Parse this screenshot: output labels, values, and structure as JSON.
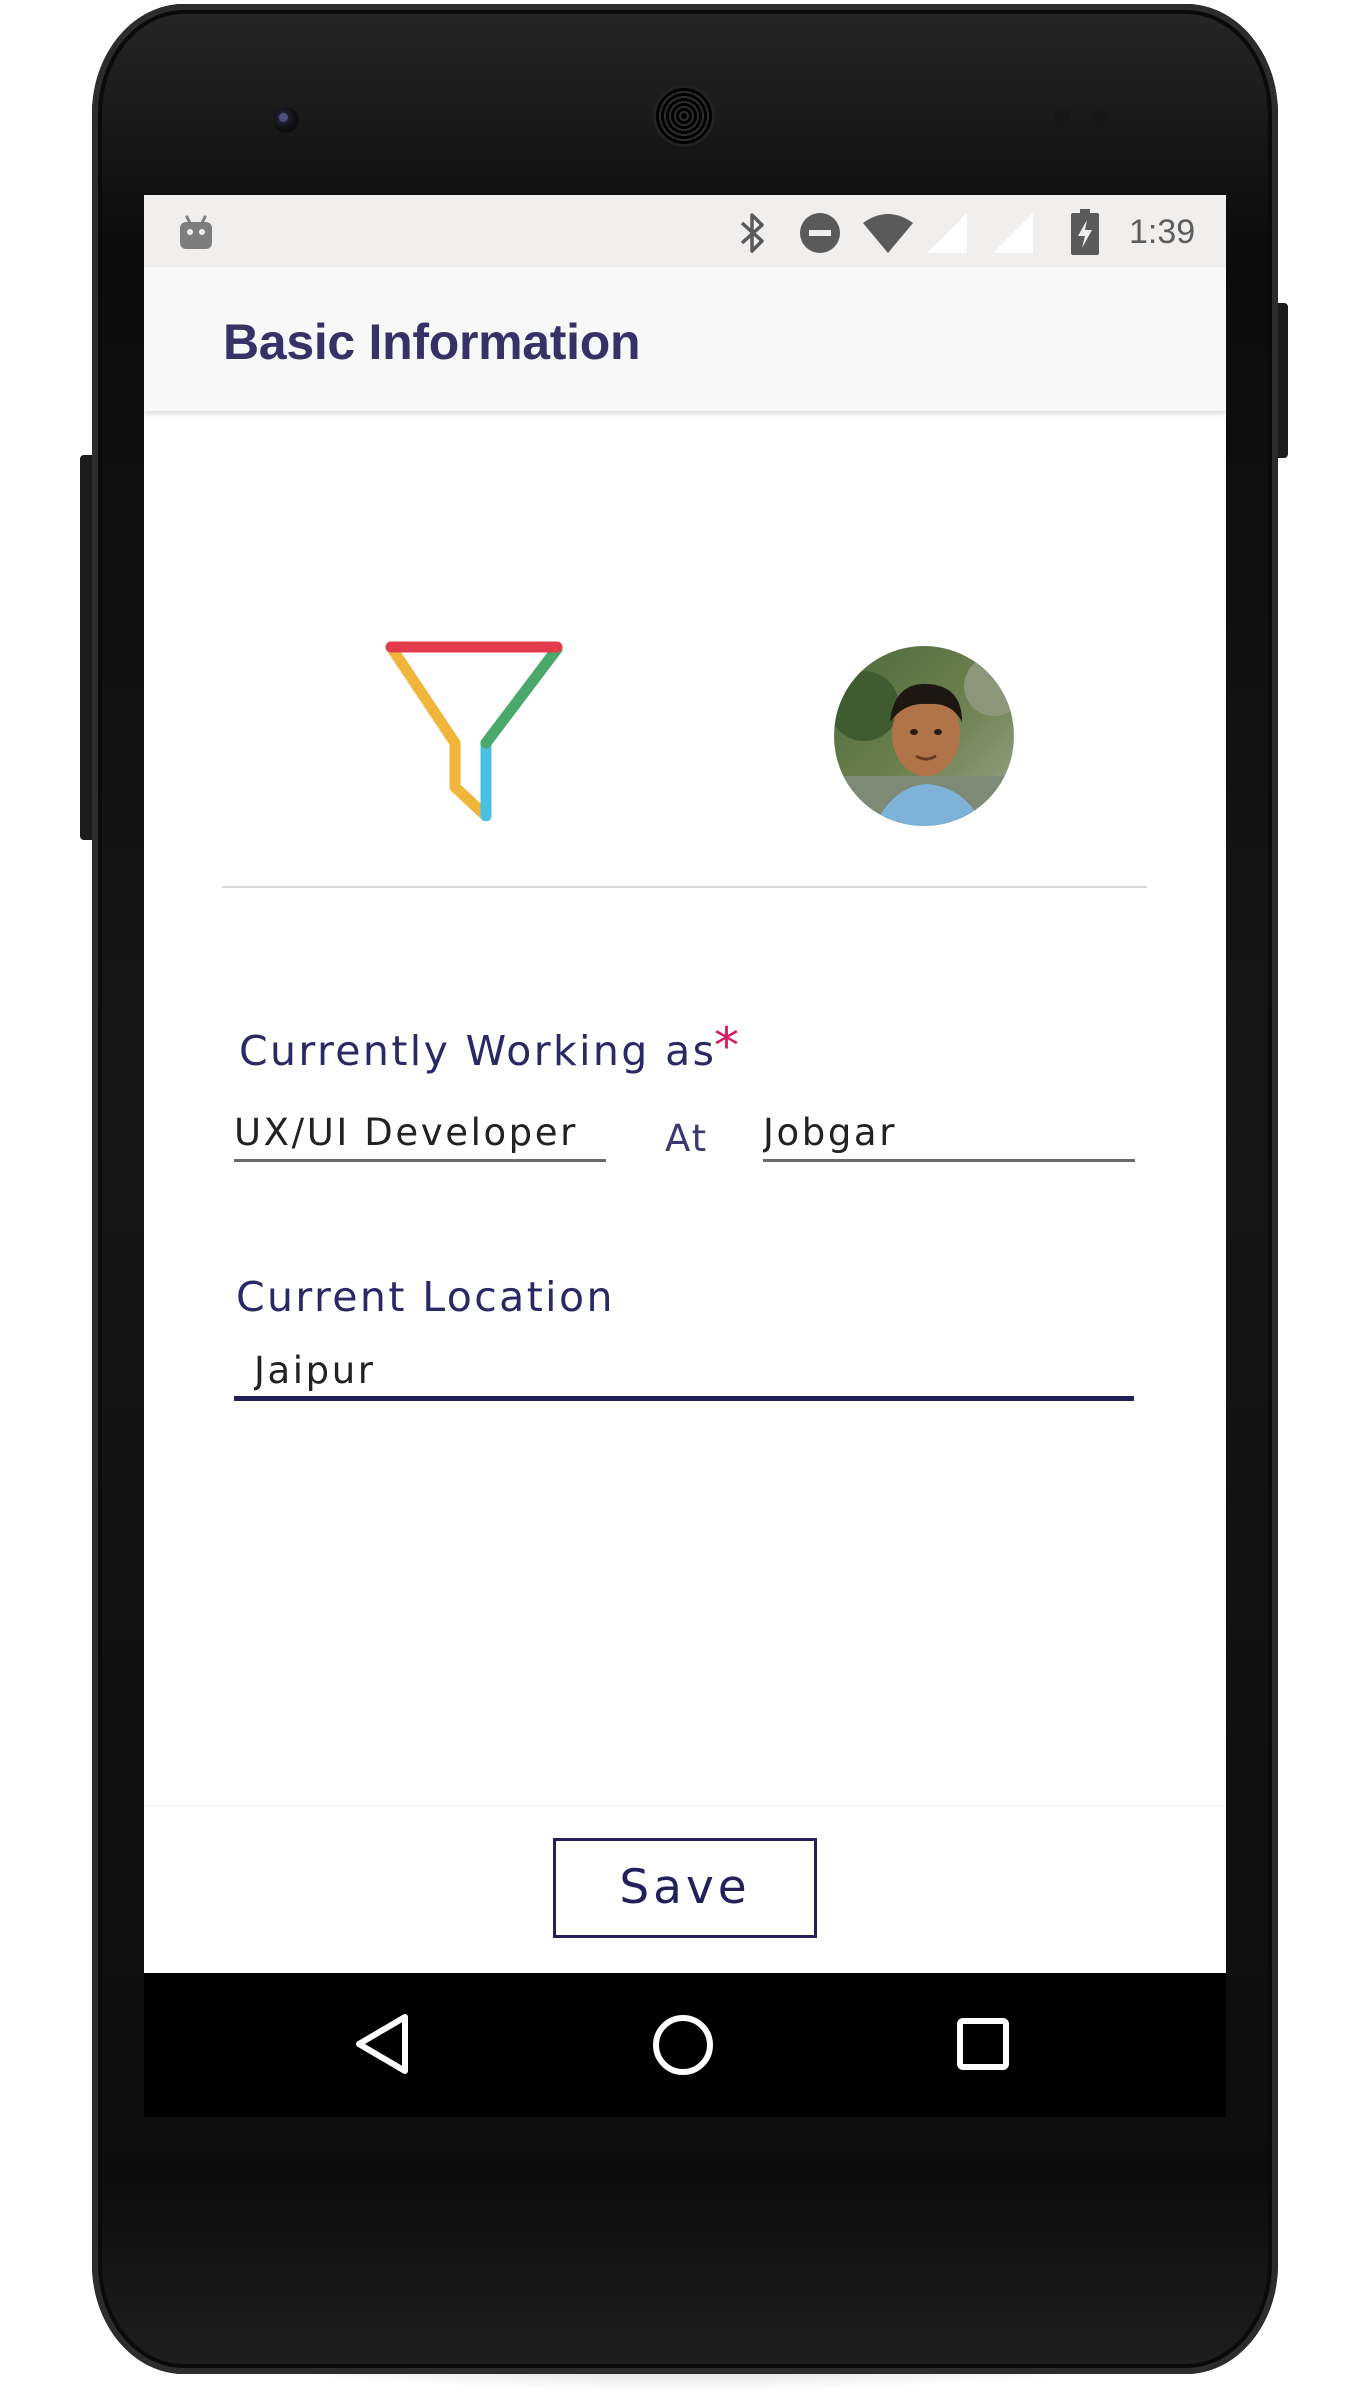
{
  "status_bar": {
    "time": "1:39",
    "icons": [
      "android-debug-icon",
      "bluetooth-icon",
      "do-not-disturb-icon",
      "wifi-icon",
      "signal-icon",
      "signal-icon",
      "battery-charging-icon"
    ]
  },
  "app_bar": {
    "title": "Basic Information"
  },
  "header": {
    "logo_icon": "brand-logo-icon",
    "avatar": "profile-photo"
  },
  "form": {
    "working_label": "Currently Working as",
    "required_marker": "*",
    "job_title_value": "UX/UI Developer",
    "at_label": "At",
    "company_value": "Jobgar",
    "location_label": "Current Location",
    "location_value": "Jaipur"
  },
  "actions": {
    "save_label": "Save"
  },
  "nav_bar": {
    "icons": [
      "back-icon",
      "home-icon",
      "recents-icon"
    ]
  },
  "colors": {
    "accent": "#2b2866",
    "title": "#363267",
    "required": "#d41a63",
    "logo_red": "#e33b4d",
    "logo_green": "#4aa86b",
    "logo_yellow": "#f2b53c",
    "logo_blue": "#4bbfe2"
  }
}
